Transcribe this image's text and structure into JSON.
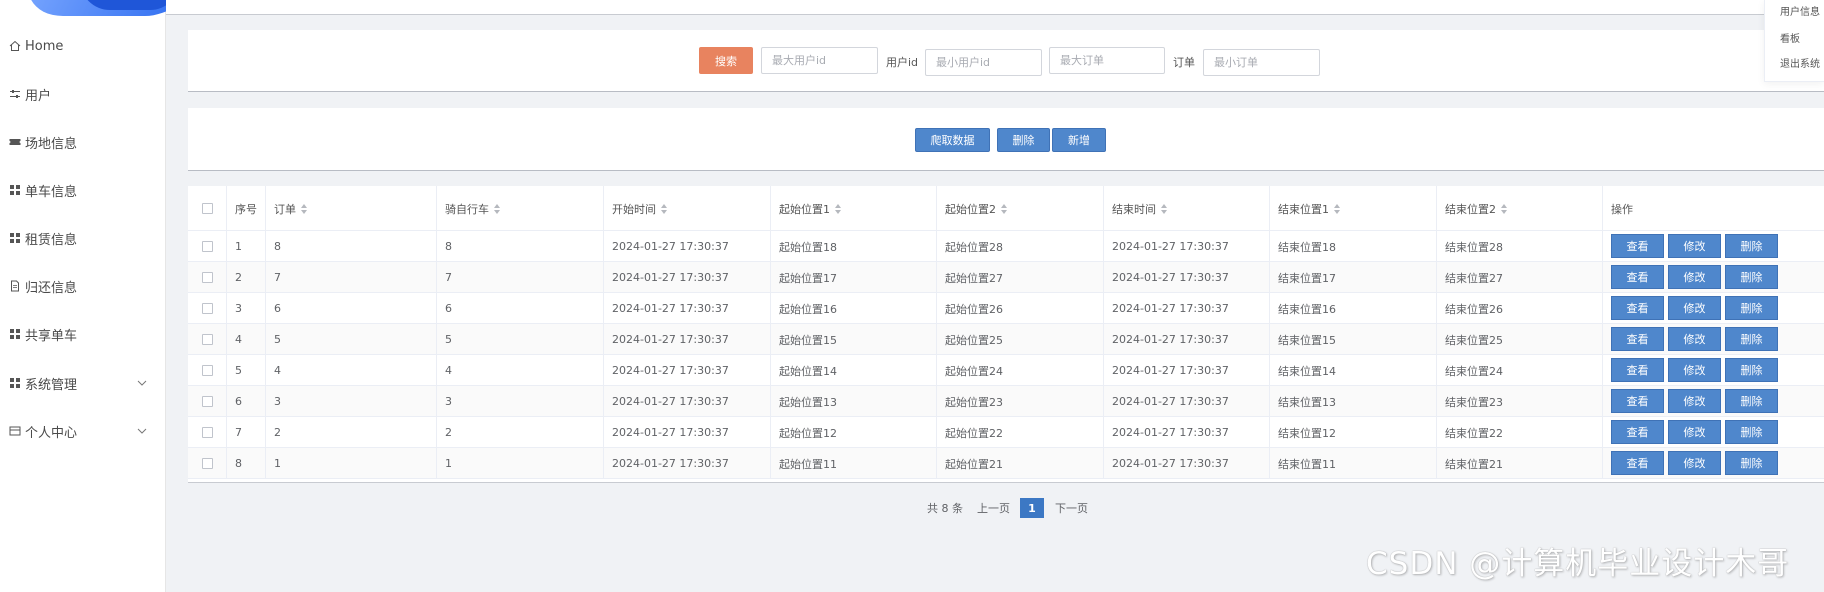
{
  "sidebar": {
    "items": [
      {
        "label": "Home",
        "icon": "home-icon"
      },
      {
        "label": "用户",
        "icon": "sliders-icon"
      },
      {
        "label": "场地信息",
        "icon": "ticket-icon"
      },
      {
        "label": "单车信息",
        "icon": "grid-icon"
      },
      {
        "label": "租赁信息",
        "icon": "grid-icon"
      },
      {
        "label": "归还信息",
        "icon": "file-icon"
      },
      {
        "label": "共享单车",
        "icon": "grid-icon"
      },
      {
        "label": "系统管理",
        "icon": "grid-icon"
      },
      {
        "label": "个人中心",
        "icon": "wallet-icon"
      }
    ]
  },
  "user_menu": {
    "items": [
      "用户信息",
      "看板",
      "退出系统"
    ]
  },
  "search": {
    "button": "搜索",
    "max_user_id_placeholder": "最大用户id",
    "user_id_label": "用户id",
    "min_user_id_placeholder": "最小用户id",
    "max_order_placeholder": "最大订单",
    "order_label": "订单",
    "min_order_placeholder": "最小订单"
  },
  "actions": {
    "crawl": "爬取数据",
    "delete": "删除",
    "add": "新增"
  },
  "table": {
    "headers": {
      "index": "序号",
      "order": "订单",
      "bike": "骑自行车",
      "start_time": "开始时间",
      "start_pos1": "起始位置1",
      "start_pos2": "起始位置2",
      "end_time": "结束时间",
      "end_pos1": "结束位置1",
      "end_pos2": "结束位置2",
      "ops": "操作"
    },
    "op_labels": {
      "view": "查看",
      "edit": "修改",
      "delete": "删除"
    },
    "rows": [
      {
        "index": "1",
        "order": "8",
        "bike": "8",
        "start_time": "2024-01-27 17:30:37",
        "start_pos1": "起始位置18",
        "start_pos2": "起始位置28",
        "end_time": "2024-01-27 17:30:37",
        "end_pos1": "结束位置18",
        "end_pos2": "结束位置28"
      },
      {
        "index": "2",
        "order": "7",
        "bike": "7",
        "start_time": "2024-01-27 17:30:37",
        "start_pos1": "起始位置17",
        "start_pos2": "起始位置27",
        "end_time": "2024-01-27 17:30:37",
        "end_pos1": "结束位置17",
        "end_pos2": "结束位置27"
      },
      {
        "index": "3",
        "order": "6",
        "bike": "6",
        "start_time": "2024-01-27 17:30:37",
        "start_pos1": "起始位置16",
        "start_pos2": "起始位置26",
        "end_time": "2024-01-27 17:30:37",
        "end_pos1": "结束位置16",
        "end_pos2": "结束位置26"
      },
      {
        "index": "4",
        "order": "5",
        "bike": "5",
        "start_time": "2024-01-27 17:30:37",
        "start_pos1": "起始位置15",
        "start_pos2": "起始位置25",
        "end_time": "2024-01-27 17:30:37",
        "end_pos1": "结束位置15",
        "end_pos2": "结束位置25"
      },
      {
        "index": "5",
        "order": "4",
        "bike": "4",
        "start_time": "2024-01-27 17:30:37",
        "start_pos1": "起始位置14",
        "start_pos2": "起始位置24",
        "end_time": "2024-01-27 17:30:37",
        "end_pos1": "结束位置14",
        "end_pos2": "结束位置24"
      },
      {
        "index": "6",
        "order": "3",
        "bike": "3",
        "start_time": "2024-01-27 17:30:37",
        "start_pos1": "起始位置13",
        "start_pos2": "起始位置23",
        "end_time": "2024-01-27 17:30:37",
        "end_pos1": "结束位置13",
        "end_pos2": "结束位置23"
      },
      {
        "index": "7",
        "order": "2",
        "bike": "2",
        "start_time": "2024-01-27 17:30:37",
        "start_pos1": "起始位置12",
        "start_pos2": "起始位置22",
        "end_time": "2024-01-27 17:30:37",
        "end_pos1": "结束位置12",
        "end_pos2": "结束位置22"
      },
      {
        "index": "8",
        "order": "1",
        "bike": "1",
        "start_time": "2024-01-27 17:30:37",
        "start_pos1": "起始位置11",
        "start_pos2": "起始位置21",
        "end_time": "2024-01-27 17:30:37",
        "end_pos1": "结束位置11",
        "end_pos2": "结束位置21"
      }
    ]
  },
  "pagination": {
    "total": "共 8 条",
    "prev": "上一页",
    "current": "1",
    "next": "下一页"
  },
  "watermark": "CSDN @计算机毕业设计木哥",
  "colors": {
    "search_button": "#e8835f",
    "primary_button": "#4f87cc",
    "active_page": "#3c78c4"
  }
}
